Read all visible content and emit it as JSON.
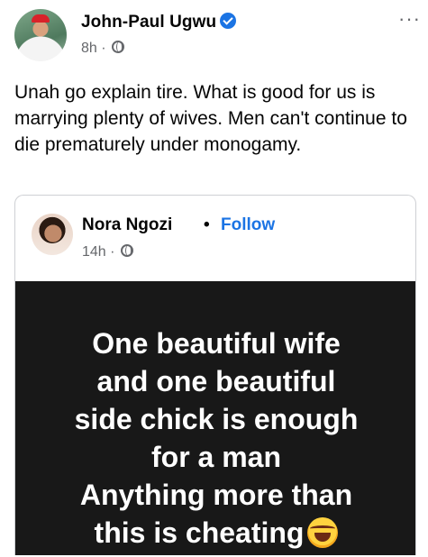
{
  "post": {
    "author": "John-Paul Ugwu",
    "time": "8h",
    "separator": "·",
    "more": "···",
    "text": "Unah go explain tire. What is good for us is marrying plenty of wives. Men can't continue to die prematurely under monogamy."
  },
  "shared": {
    "author": "Nora Ngozi",
    "dot": "•",
    "follow_label": "Follow",
    "time": "14h",
    "separator": "·",
    "quote_lines": [
      "One beautiful wife",
      "and one beautiful",
      "side chick is enough",
      "for a man",
      "Anything more than",
      "this is cheating"
    ]
  },
  "icons": {
    "verified": "verified-badge-icon",
    "privacy": "globe-icon",
    "more": "more-options-icon",
    "emoji": "laughing-tears-emoji-icon"
  },
  "colors": {
    "accent": "#1b74e4",
    "secondary_text": "#65676b",
    "quote_bg": "#181818"
  }
}
